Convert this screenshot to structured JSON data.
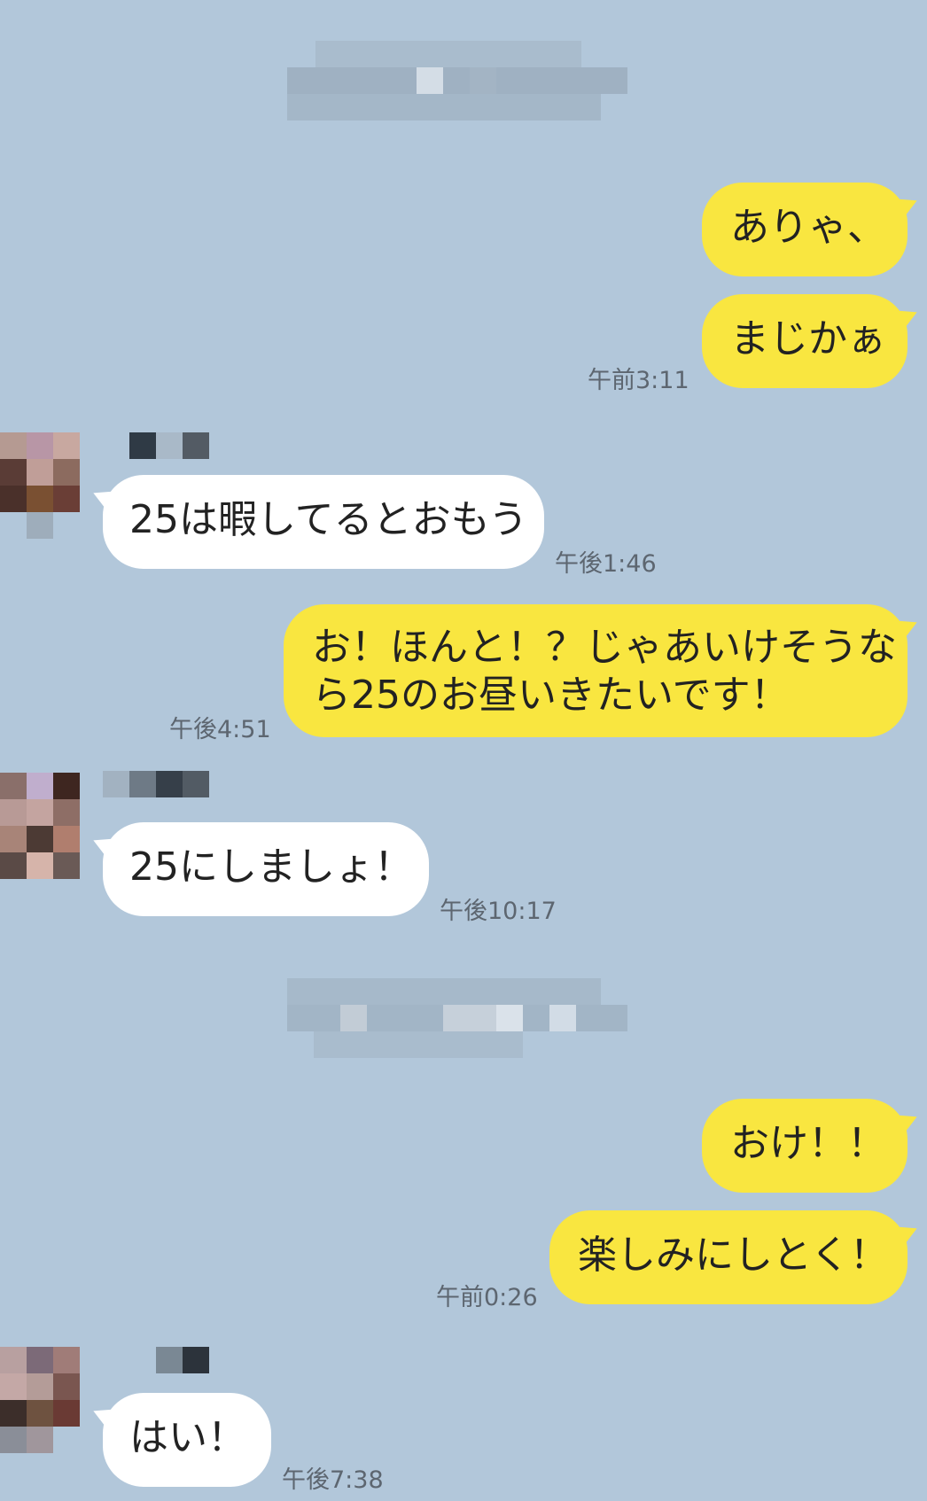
{
  "messages": [
    {
      "side": "me",
      "text": "ありゃ、"
    },
    {
      "side": "me",
      "text": "まじかぁ",
      "time": "午前3:11"
    },
    {
      "side": "them",
      "text": "25は暇してるとおもう",
      "time": "午後1:46"
    },
    {
      "side": "me",
      "lines": [
        "お！ほんと！？じゃあいけそうな",
        "ら25のお昼いきたいです！"
      ],
      "time": "午後4:51"
    },
    {
      "side": "them",
      "text": "25にしましょ！",
      "time": "午後10:17"
    },
    {
      "side": "me",
      "text": "おけ！！"
    },
    {
      "side": "me",
      "text": "楽しみにしとく！",
      "time": "午前0:26"
    },
    {
      "side": "them",
      "text": "はい！",
      "time": "午後7:38"
    }
  ],
  "colors": {
    "background": "#b2c7da",
    "my_bubble": "#f9e640",
    "their_bubble": "#ffffff",
    "timestamp": "#5d6670"
  },
  "redacted": [
    "date-separator",
    "avatar",
    "sender-name"
  ]
}
